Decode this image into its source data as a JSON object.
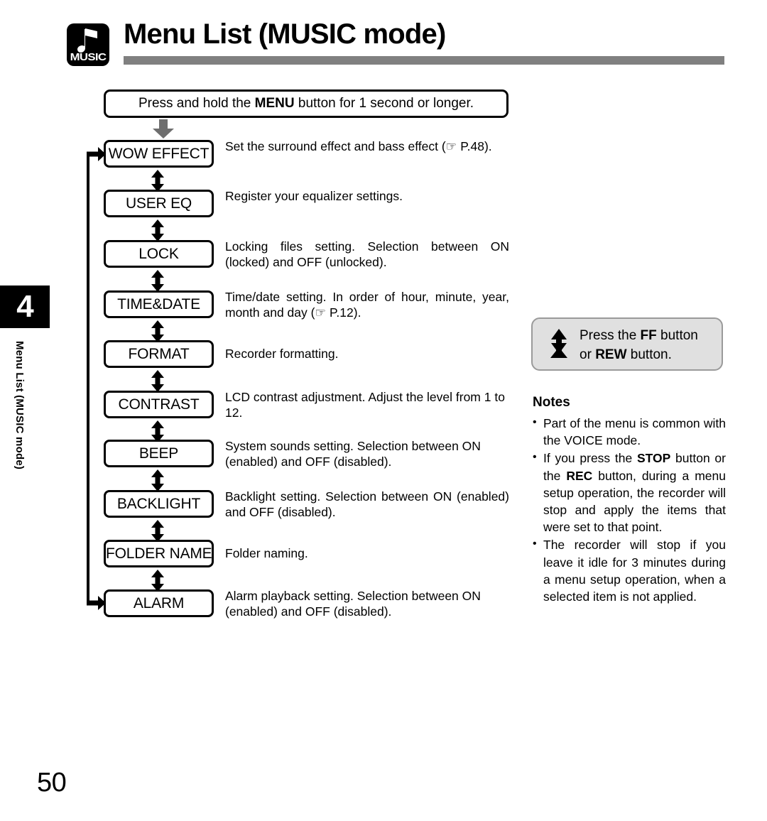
{
  "header": {
    "badge_label": "MUSIC",
    "badge_icon": "music-note-icon",
    "title": "Menu List (MUSIC mode)"
  },
  "chapter_tab": {
    "number": "4",
    "vertical_label": "Menu List (MUSIC mode)"
  },
  "flow": {
    "intro_prefix": "Press and hold the ",
    "intro_bold": "MENU",
    "intro_suffix": " button for 1 second or longer.",
    "down_arrow_icon": "arrow-down-icon",
    "loop_arrow_icon": "arrow-right-icon",
    "connector_icon": "arrow-up-down-icon",
    "items": [
      {
        "label": "WOW EFFECT",
        "description": "Set the surround effect and bass effect (☞ P.48)."
      },
      {
        "label": "USER EQ",
        "description": "Register your equalizer settings."
      },
      {
        "label": "LOCK",
        "description": "Locking files setting. Selection between ON (locked) and OFF (unlocked)."
      },
      {
        "label": "TIME&DATE",
        "description": "Time/date setting. In order of hour, minute, year, month and day (☞ P.12)."
      },
      {
        "label": "FORMAT",
        "description": "Recorder formatting."
      },
      {
        "label": "CONTRAST",
        "description": "LCD contrast adjustment. Adjust the level from 1 to 12."
      },
      {
        "label": "BEEP",
        "description": "System sounds setting. Selection between ON (enabled) and OFF (disabled)."
      },
      {
        "label": "BACKLIGHT",
        "description": "Backlight setting. Selection between ON (enabled) and OFF (disabled)."
      },
      {
        "label": "FOLDER NAME",
        "description": "Folder naming."
      },
      {
        "label": "ALARM",
        "description": "Alarm playback setting. Selection between ON (enabled) and OFF (disabled)."
      }
    ]
  },
  "side_panel": {
    "ff_rew_icon": "arrow-up-down-icon",
    "ff_rew_line1_prefix": "Press the ",
    "ff_rew_line1_bold": "FF",
    "ff_rew_line1_suffix": " button",
    "ff_rew_line2_prefix": "or ",
    "ff_rew_line2_bold": "REW",
    "ff_rew_line2_suffix": " button.",
    "notes_title": "Notes",
    "notes": [
      "Part of the menu is common with the VOICE mode.",
      "If you press the STOP button or the REC button, during a menu setup operation, the recorder will stop and apply the items that were set to that point.",
      "The recorder will stop if you leave it idle for 3 minutes during a menu setup operation, when a selected item is not applied."
    ]
  },
  "footer": {
    "page_number": "50"
  },
  "colors": {
    "rule_gray": "#808080",
    "arrow_gray": "#6e6e6e",
    "panel_gray": "#e0e0e0",
    "ink": "#000000"
  }
}
